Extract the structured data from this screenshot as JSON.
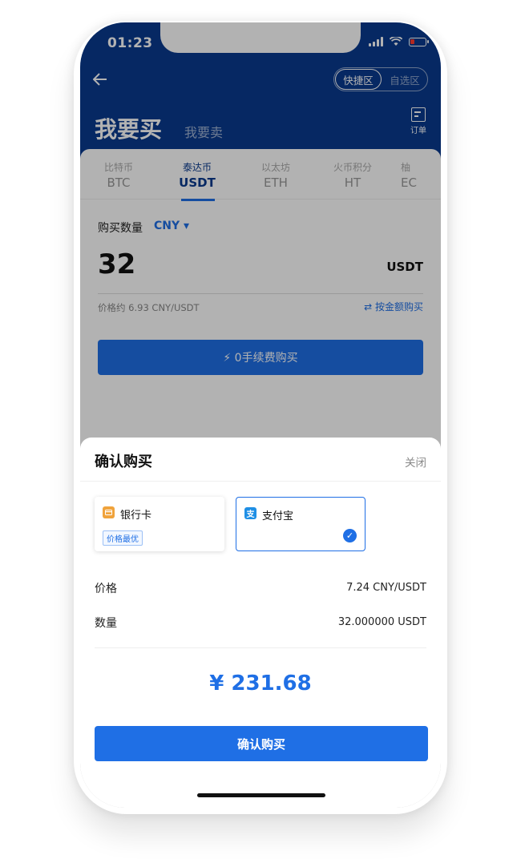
{
  "status_bar": {
    "time": "01:23"
  },
  "header": {
    "zone_quick": "快捷区",
    "zone_custom": "自选区",
    "title_buy": "我要买",
    "title_sell": "我要卖",
    "orders_label": "订单",
    "back_icon": "arrow-left-icon"
  },
  "tabs": [
    {
      "sub": "比特币",
      "main": "BTC"
    },
    {
      "sub": "泰达币",
      "main": "USDT"
    },
    {
      "sub": "以太坊",
      "main": "ETH"
    },
    {
      "sub": "火币积分",
      "main": "HT"
    },
    {
      "sub": "柚",
      "main": "EC"
    }
  ],
  "form": {
    "qty_label": "购买数量",
    "currency": "CNY ▾",
    "qty_value": "32",
    "qty_unit": "USDT",
    "price_approx": "价格约 6.93 CNY/USDT",
    "by_amount": "⇄ 按金额购买",
    "buy_button": "⚡ 0手续费购买"
  },
  "sheet": {
    "title": "确认购买",
    "close": "关闭",
    "methods": [
      {
        "name": "银行卡",
        "badge": "价格最优",
        "icon": "bank-card-icon",
        "color": "#f0a33c"
      },
      {
        "name": "支付宝",
        "icon": "alipay-icon",
        "icon_text": "支",
        "color": "#1f8fe5",
        "selected": true
      }
    ],
    "price_label": "价格",
    "price_value": "7.24 CNY/USDT",
    "qty_label": "数量",
    "qty_value": "32.000000 USDT",
    "total": "¥ 231.68",
    "confirm": "确认购买"
  },
  "colors": {
    "header": "#0a3a8f",
    "accent": "#1f6fe5"
  }
}
